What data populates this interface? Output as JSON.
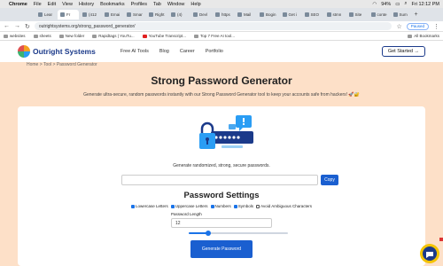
{
  "menubar": {
    "items": [
      "Chrome",
      "File",
      "Edit",
      "View",
      "History",
      "Bookmarks",
      "Profiles",
      "Tab",
      "Window",
      "Help"
    ],
    "battery": "94%",
    "clock": "Fri 12:12 PM"
  },
  "tabs": [
    {
      "label": "Lear",
      "active": false
    },
    {
      "label": "Fr",
      "active": true
    },
    {
      "label": "(412",
      "active": false
    },
    {
      "label": "Emai",
      "active": false
    },
    {
      "label": "Smar",
      "active": false
    },
    {
      "label": "Right",
      "active": false
    },
    {
      "label": "(4)",
      "active": false
    },
    {
      "label": "Devl",
      "active": false
    },
    {
      "label": "https",
      "active": false
    },
    {
      "label": "Mail",
      "active": false
    },
    {
      "label": "Bogin",
      "active": false
    },
    {
      "label": "Get i",
      "active": false
    },
    {
      "label": "SEO",
      "active": false
    },
    {
      "label": "stmn",
      "active": false
    },
    {
      "label": "Site",
      "active": false
    },
    {
      "label": "conte",
      "active": false
    },
    {
      "label": "Sum",
      "active": false
    }
  ],
  "address": {
    "url": "outrightsystems.org/strong_password_generator/",
    "paused_label": "Paused"
  },
  "bookmarks": {
    "items": [
      "websites",
      "sheets",
      "New folder",
      "Rapidtags | YouTu...",
      "YouTube Transcript...",
      "Top 7 Free AI tool..."
    ],
    "all_label": "All Bookmarks"
  },
  "site": {
    "logo_text": "Outright Systems",
    "nav": [
      "Free AI Tools",
      "Blog",
      "Career",
      "Portfolio"
    ],
    "cta": "Get Started →",
    "breadcrumb": "Home > Tool > Password Generator"
  },
  "page": {
    "title": "Strong Password Generator",
    "subtitle": "Generate ultra-secure, random passwords instantly with our Strong Password Generator tool to keep your accounts safe from hackers! 🚀🔐",
    "tagline": "Generate randomized, strong, secure passwords.",
    "password_value": "",
    "copy_label": "Copy",
    "settings_title": "Password Settings",
    "options": [
      {
        "label": "Lowercase Letters",
        "checked": true
      },
      {
        "label": "Uppercase Letters",
        "checked": true
      },
      {
        "label": "Numbers",
        "checked": true
      },
      {
        "label": "Symbols",
        "checked": true
      },
      {
        "label": "Avoid Ambiguous Characters",
        "checked": false
      }
    ],
    "length_label": "Password Length",
    "length_value": "12",
    "slider_fraction": 0.2,
    "generate_label": "Generate Password"
  },
  "colors": {
    "accent": "#1a5fd0",
    "page_bg": "#fde0c8",
    "brand": "#1b3a8a"
  }
}
